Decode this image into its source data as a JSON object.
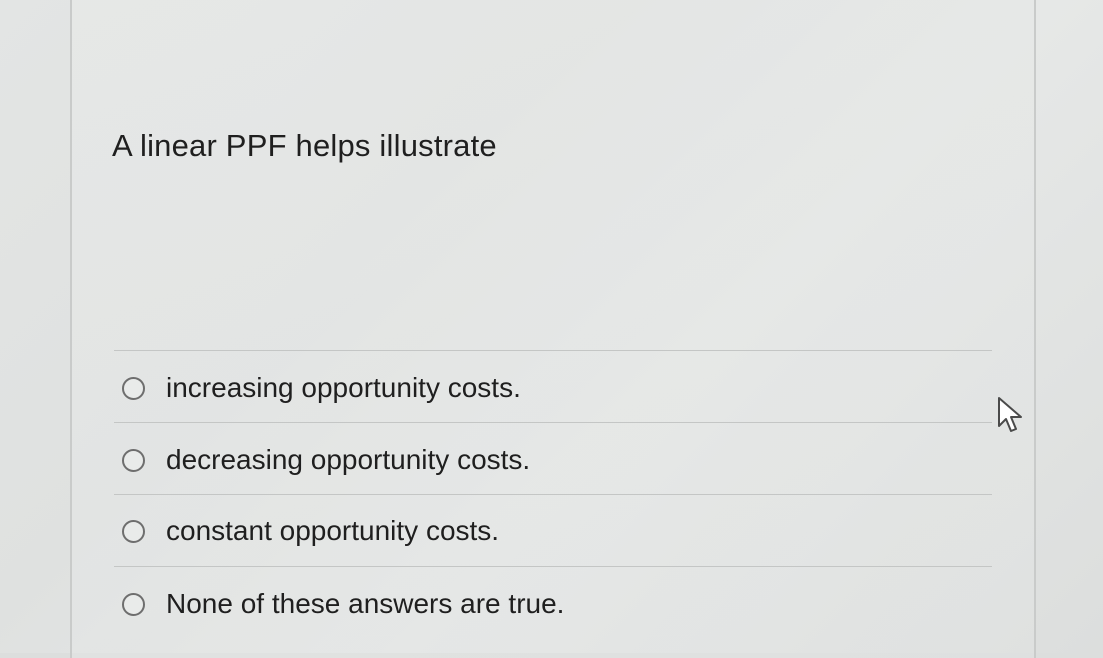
{
  "question": {
    "text": "A linear PPF helps illustrate"
  },
  "options": [
    {
      "label": "increasing opportunity costs.",
      "selected": false
    },
    {
      "label": "decreasing opportunity costs.",
      "selected": false
    },
    {
      "label": "constant opportunity costs.",
      "selected": false
    },
    {
      "label": "None of these answers are true.",
      "selected": false
    }
  ],
  "icons": {
    "radio": "radio-button-icon",
    "cursor": "mouse-pointer-icon"
  }
}
